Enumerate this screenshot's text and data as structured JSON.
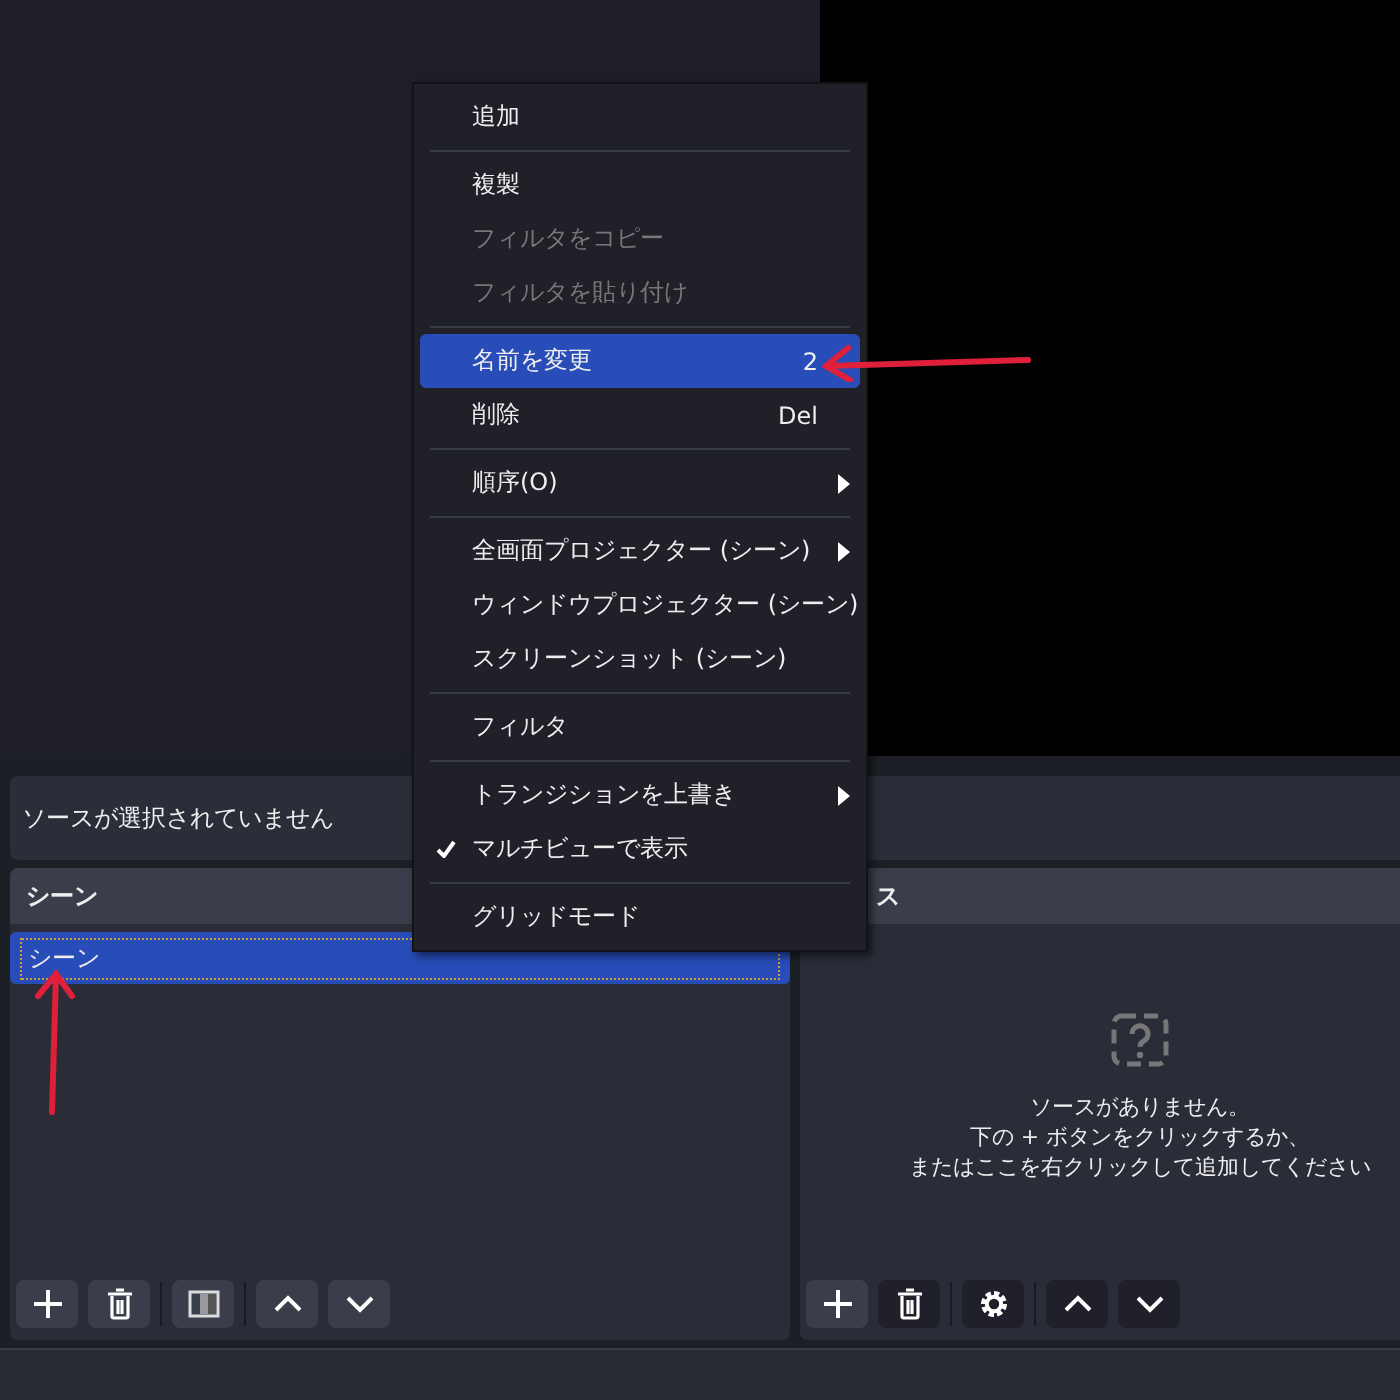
{
  "info_bar": {
    "text": "ソースが選択されていません"
  },
  "scenes": {
    "title": "シーン",
    "items": [
      {
        "label": "シーン",
        "selected": true
      }
    ]
  },
  "sources": {
    "title": "ス",
    "empty_lines": [
      "ソースがありません。",
      "下の + ボタンをクリックするか、",
      "またはここを右クリックして追加してください"
    ]
  },
  "context_menu": [
    {
      "kind": "item",
      "label": "追加",
      "disabled": false,
      "checked": false,
      "submenu": false,
      "selected": false
    },
    {
      "kind": "separator"
    },
    {
      "kind": "item",
      "label": "複製",
      "disabled": false,
      "checked": false,
      "submenu": false,
      "selected": false
    },
    {
      "kind": "item",
      "label": "フィルタをコピー",
      "disabled": true,
      "checked": false,
      "submenu": false,
      "selected": false
    },
    {
      "kind": "item",
      "label": "フィルタを貼り付け",
      "disabled": true,
      "checked": false,
      "submenu": false,
      "selected": false
    },
    {
      "kind": "separator"
    },
    {
      "kind": "item",
      "label": "名前を変更",
      "shortcut": "2",
      "disabled": false,
      "checked": false,
      "submenu": false,
      "selected": true
    },
    {
      "kind": "item",
      "label": "削除",
      "shortcut": "Del",
      "disabled": false,
      "checked": false,
      "submenu": false,
      "selected": false
    },
    {
      "kind": "separator"
    },
    {
      "kind": "item",
      "label": "順序(O)",
      "disabled": false,
      "checked": false,
      "submenu": true,
      "selected": false
    },
    {
      "kind": "separator"
    },
    {
      "kind": "item",
      "label": "全画面プロジェクター (シーン)",
      "disabled": false,
      "checked": false,
      "submenu": true,
      "selected": false
    },
    {
      "kind": "item",
      "label": "ウィンドウプロジェクター (シーン)",
      "disabled": false,
      "checked": false,
      "submenu": false,
      "selected": false
    },
    {
      "kind": "item",
      "label": "スクリーンショット (シーン)",
      "disabled": false,
      "checked": false,
      "submenu": false,
      "selected": false
    },
    {
      "kind": "separator"
    },
    {
      "kind": "item",
      "label": "フィルタ",
      "disabled": false,
      "checked": false,
      "submenu": false,
      "selected": false
    },
    {
      "kind": "separator"
    },
    {
      "kind": "item",
      "label": "トランジションを上書き",
      "disabled": false,
      "checked": false,
      "submenu": true,
      "selected": false
    },
    {
      "kind": "item",
      "label": "マルチビューで表示",
      "disabled": false,
      "checked": true,
      "submenu": false,
      "selected": false
    },
    {
      "kind": "separator"
    },
    {
      "kind": "item",
      "label": "グリッドモード",
      "disabled": false,
      "checked": false,
      "submenu": false,
      "selected": false
    }
  ]
}
